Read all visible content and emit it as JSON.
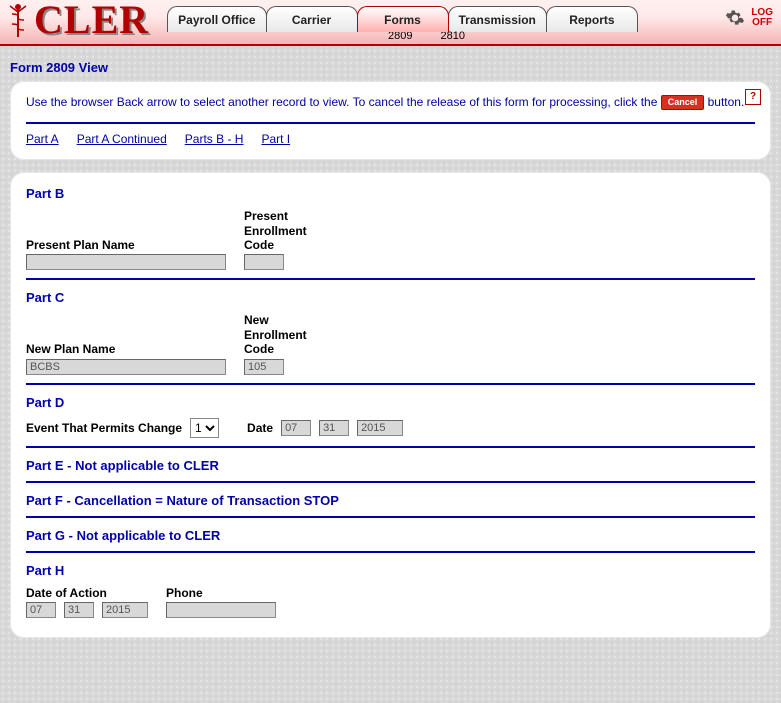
{
  "app": {
    "logo_text": "CLER",
    "logoff_line1": "LOG",
    "logoff_line2": "OFF"
  },
  "tabs": {
    "payroll": "Payroll Office",
    "carrier": "Carrier",
    "forms": "Forms",
    "transmission": "Transmission",
    "reports": "Reports"
  },
  "subtabs": {
    "t2809": "2809",
    "t2810": "2810"
  },
  "page_title": "Form 2809 View",
  "help": "?",
  "instructions": {
    "before": "Use the browser Back arrow to select another record to view.  To cancel the release of this form for processing, click the ",
    "cancel_label": "Cancel",
    "after": " button."
  },
  "anchors": {
    "part_a": "Part A",
    "part_a_cont": "Part A Continued",
    "parts_b_h": "Parts B - H",
    "part_i": "Part I"
  },
  "partB": {
    "title": "Part B",
    "present_plan_label": "Present Plan Name",
    "present_plan_value": "",
    "present_code_label_l1": "Present",
    "present_code_label_l2": "Enrollment",
    "present_code_label_l3": "Code",
    "present_code_value": ""
  },
  "partC": {
    "title": "Part C",
    "new_plan_label": "New Plan Name",
    "new_plan_value": "BCBS",
    "new_code_label_l1": "New",
    "new_code_label_l2": "Enrollment",
    "new_code_label_l3": "Code",
    "new_code_value": "105"
  },
  "partD": {
    "title": "Part D",
    "event_label": "Event That Permits Change",
    "event_value": "1",
    "date_label": "Date",
    "date_mm": "07",
    "date_dd": "31",
    "date_yyyy": "2015"
  },
  "partE": {
    "title": "Part E - Not applicable to CLER"
  },
  "partF": {
    "title": "Part F - Cancellation = Nature of Transaction STOP"
  },
  "partG": {
    "title": "Part G - Not applicable to CLER"
  },
  "partH": {
    "title": "Part H",
    "doa_label": "Date of Action",
    "doa_mm": "07",
    "doa_dd": "31",
    "doa_yyyy": "2015",
    "phone_label": "Phone",
    "phone_value": ""
  }
}
